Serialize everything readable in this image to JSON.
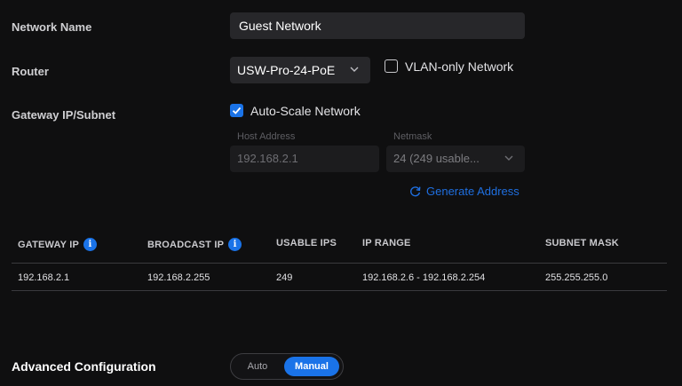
{
  "network_name": {
    "label": "Network Name",
    "value": "Guest Network"
  },
  "router": {
    "label": "Router",
    "selected": "USW-Pro-24-PoE"
  },
  "vlan_only": {
    "label": "VLAN-only Network",
    "checked": false
  },
  "gateway": {
    "label": "Gateway IP/Subnet",
    "auto_scale_label": "Auto-Scale Network",
    "auto_scale_checked": true,
    "host_address_label": "Host Address",
    "host_address_value": "192.168.2.1",
    "netmask_label": "Netmask",
    "netmask_value": "24 (249 usable...",
    "generate_label": "Generate Address"
  },
  "table": {
    "headers": [
      "GATEWAY IP",
      "BROADCAST IP",
      "USABLE IPS",
      "IP RANGE",
      "SUBNET MASK"
    ],
    "rows": [
      [
        "192.168.2.1",
        "192.168.2.255",
        "249",
        "192.168.2.6 - 192.168.2.254",
        "255.255.255.0"
      ]
    ]
  },
  "advanced": {
    "label": "Advanced Configuration",
    "options": [
      "Auto",
      "Manual"
    ],
    "selected": "Manual"
  },
  "colors": {
    "accent": "#1a73e8",
    "background": "#0f0f10",
    "field": "#27272a"
  }
}
